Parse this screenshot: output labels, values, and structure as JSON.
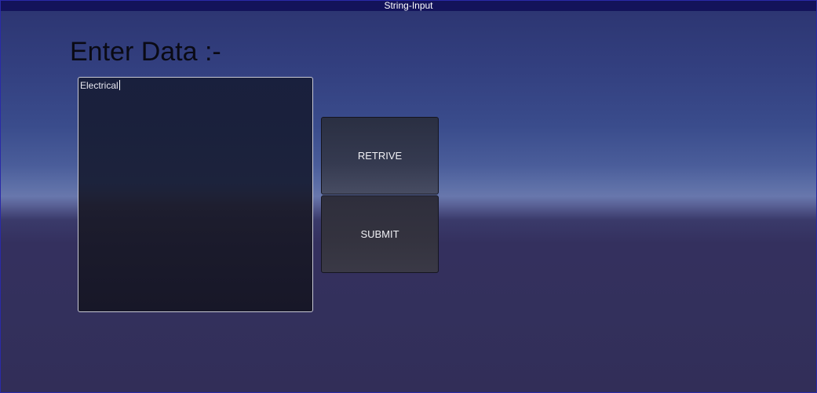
{
  "window": {
    "title": "String-Input"
  },
  "main": {
    "heading": "Enter Data :-",
    "input": {
      "value": "Electrical"
    },
    "buttons": {
      "retrive": "RETRIVE",
      "submit": "SUBMIT"
    }
  }
}
